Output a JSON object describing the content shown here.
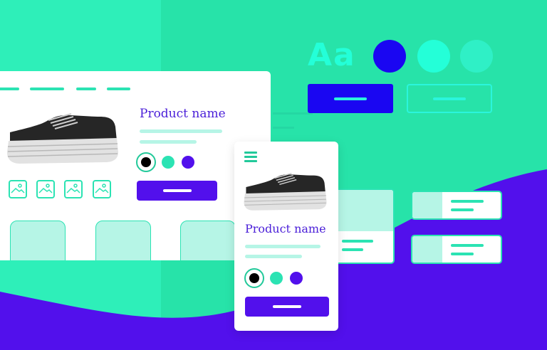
{
  "style_guide": {
    "typography_sample": "Aa",
    "swatches": [
      "#1a06f2",
      "#24ffd8",
      "#2ff0c6"
    ]
  },
  "desktop": {
    "product_name": "Product name",
    "color_options": [
      "#000000",
      "#2be3b3",
      "#5210ec"
    ]
  },
  "mobile": {
    "product_name": "Product name",
    "color_options": [
      "#000000",
      "#2be3b3",
      "#5210ec"
    ]
  },
  "colors": {
    "background": "#27e3a9",
    "accent_purple": "#5210ec",
    "accent_blue": "#1a06f2"
  }
}
